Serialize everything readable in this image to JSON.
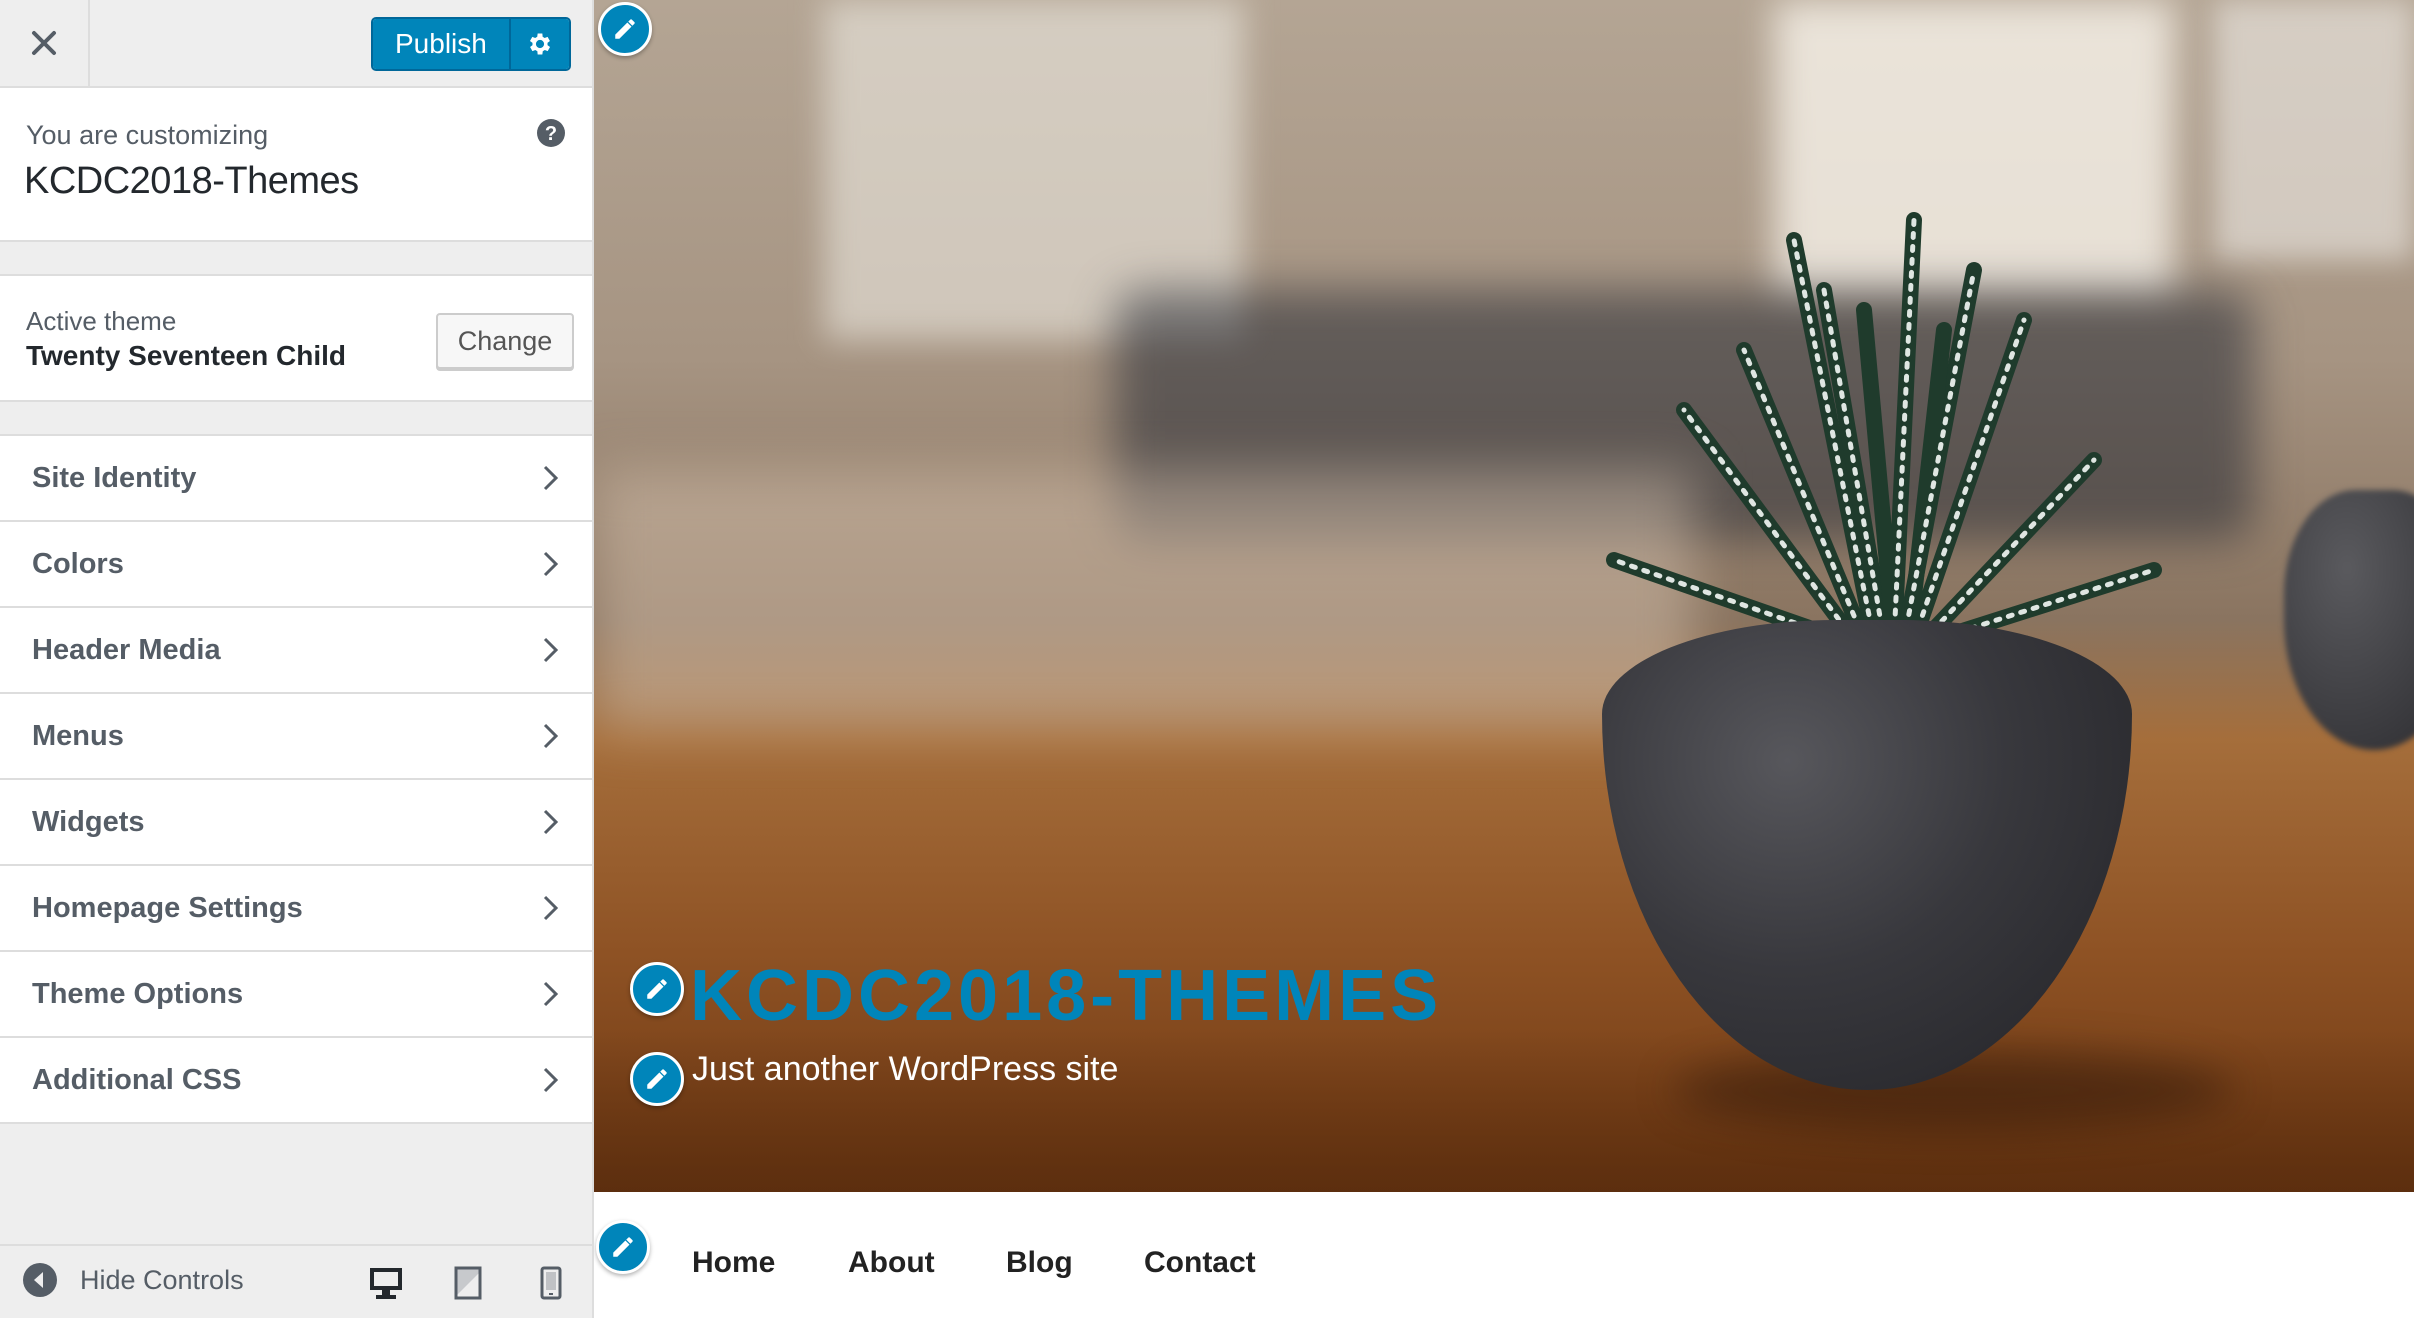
{
  "topbar": {
    "close_icon": "close-icon",
    "publish_label": "Publish",
    "settings_icon": "gear-icon"
  },
  "info": {
    "caption": "You are customizing",
    "site_name": "KCDC2018-Themes",
    "help_icon": "help-icon"
  },
  "theme": {
    "caption": "Active theme",
    "name": "Twenty Seventeen Child",
    "change_label": "Change"
  },
  "panels": [
    {
      "label": "Site Identity"
    },
    {
      "label": "Colors"
    },
    {
      "label": "Header Media"
    },
    {
      "label": "Menus"
    },
    {
      "label": "Widgets"
    },
    {
      "label": "Homepage Settings"
    },
    {
      "label": "Theme Options"
    },
    {
      "label": "Additional CSS"
    }
  ],
  "footer": {
    "hide_controls_label": "Hide Controls",
    "devices": [
      "desktop-icon",
      "tablet-icon",
      "mobile-icon"
    ]
  },
  "preview": {
    "site_title": "KCDC2018-THEMES",
    "tagline": "Just another WordPress site",
    "nav": [
      "Home",
      "About",
      "Blog",
      "Contact"
    ]
  },
  "colors": {
    "accent": "#0085ba",
    "sidebar_bg": "#eeeeee"
  }
}
